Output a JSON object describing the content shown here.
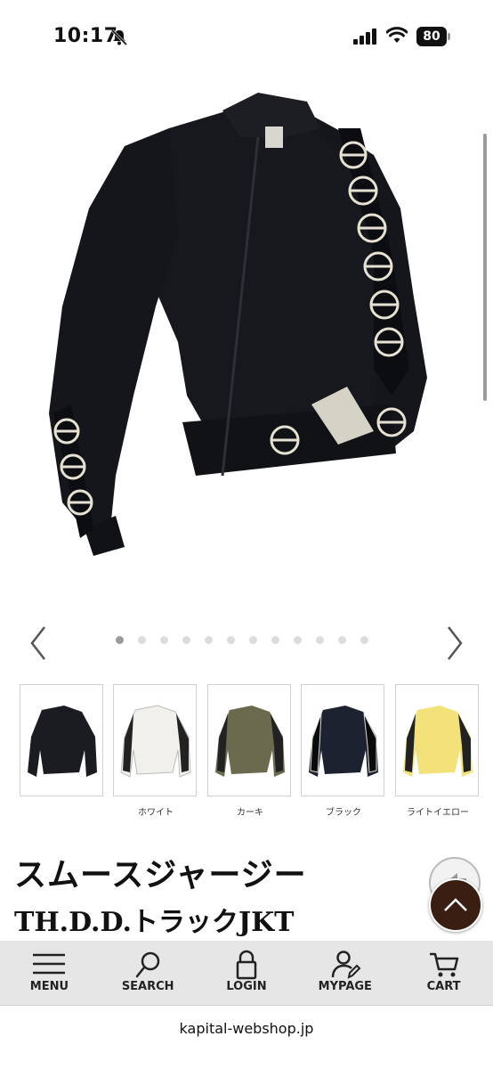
{
  "status_bar": {
    "time": "10:17",
    "battery": "80"
  },
  "carousel": {
    "dot_count": 12,
    "active_index": 0
  },
  "thumbnails": [
    {
      "label": "",
      "color": "#1a1c22"
    },
    {
      "label": "ホワイト",
      "color": "#f2f0ea"
    },
    {
      "label": "カーキ",
      "color": "#6b6a4e"
    },
    {
      "label": "ブラック",
      "color": "#1d2230"
    },
    {
      "label": "ライトイエロー",
      "color": "#f3e27a"
    }
  ],
  "product": {
    "title_line1": "スムースジャージー",
    "title_line2": "TH.D.D.トラックJKT"
  },
  "bottom_nav": {
    "menu": "MENU",
    "search": "SEARCH",
    "login": "LOGIN",
    "mypage": "MYPAGE",
    "cart": "CART"
  },
  "url": "kapital-webshop.jp",
  "colors": {
    "top_button": "#3a1e12",
    "nav_bg": "#e6e6e6",
    "jacket": "#16181d"
  }
}
